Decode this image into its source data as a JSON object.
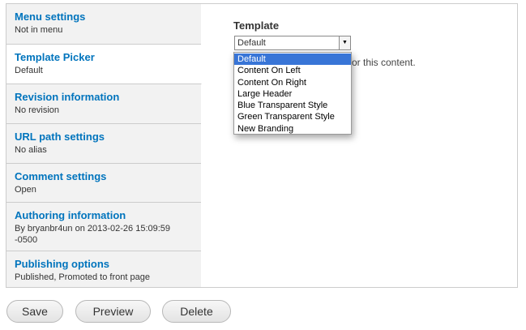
{
  "vertical_tabs": [
    {
      "title": "Menu settings",
      "summary": "Not in menu"
    },
    {
      "title": "Template Picker",
      "summary": "Default"
    },
    {
      "title": "Revision information",
      "summary": "No revision"
    },
    {
      "title": "URL path settings",
      "summary": "No alias"
    },
    {
      "title": "Comment settings",
      "summary": "Open"
    },
    {
      "title": "Authoring information",
      "summary": "By bryanbr4un on 2013-02-26 15:09:59 -0500"
    },
    {
      "title": "Publishing options",
      "summary": "Published, Promoted to front page"
    }
  ],
  "template_field": {
    "label": "Template",
    "selected_value": "Default",
    "description_fragment": "or this content.",
    "options": [
      "Default",
      "Content On Left",
      "Content On Right",
      "Large Header",
      "Blue Transparent Style",
      "Green Transparent Style",
      "New Branding"
    ]
  },
  "actions": {
    "save_label": "Save",
    "preview_label": "Preview",
    "delete_label": "Delete"
  },
  "colors": {
    "link_blue": "#0074bd",
    "selection_blue": "#3875d7",
    "tab_background": "#f2f2f2"
  }
}
